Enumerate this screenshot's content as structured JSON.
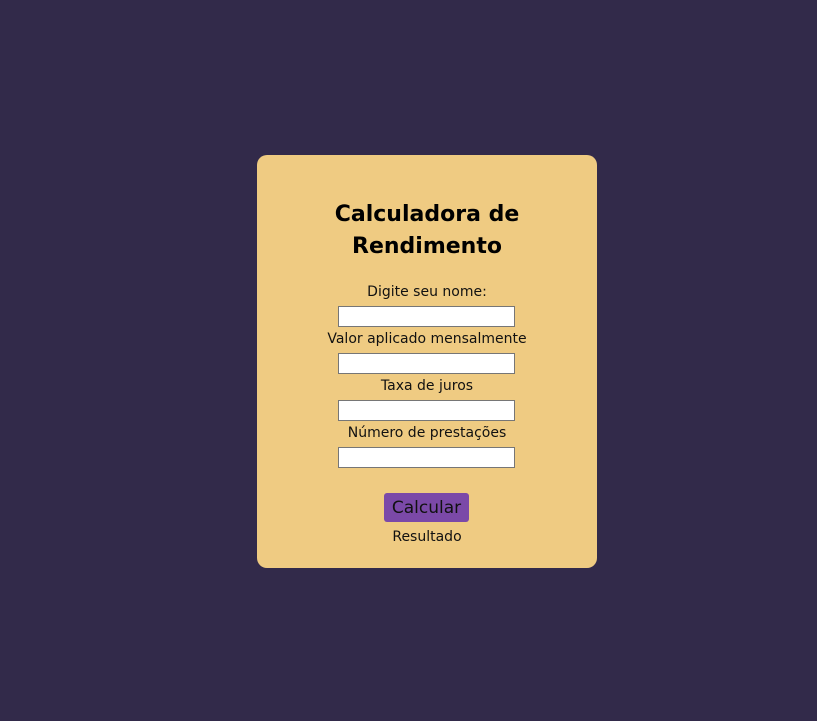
{
  "card": {
    "title": "Calculadora de Rendimento",
    "fields": [
      {
        "label": "Digite seu nome:",
        "value": "",
        "placeholder": ""
      },
      {
        "label": "Valor aplicado mensalmente",
        "value": "",
        "placeholder": ""
      },
      {
        "label": "Taxa de juros",
        "value": "",
        "placeholder": ""
      },
      {
        "label": "Número de prestações",
        "value": "",
        "placeholder": ""
      }
    ],
    "button_label": "Calcular",
    "result_text": "Resultado"
  },
  "colors": {
    "background": "#322a4a",
    "card": "#efcb82",
    "button": "#7b49a8"
  }
}
